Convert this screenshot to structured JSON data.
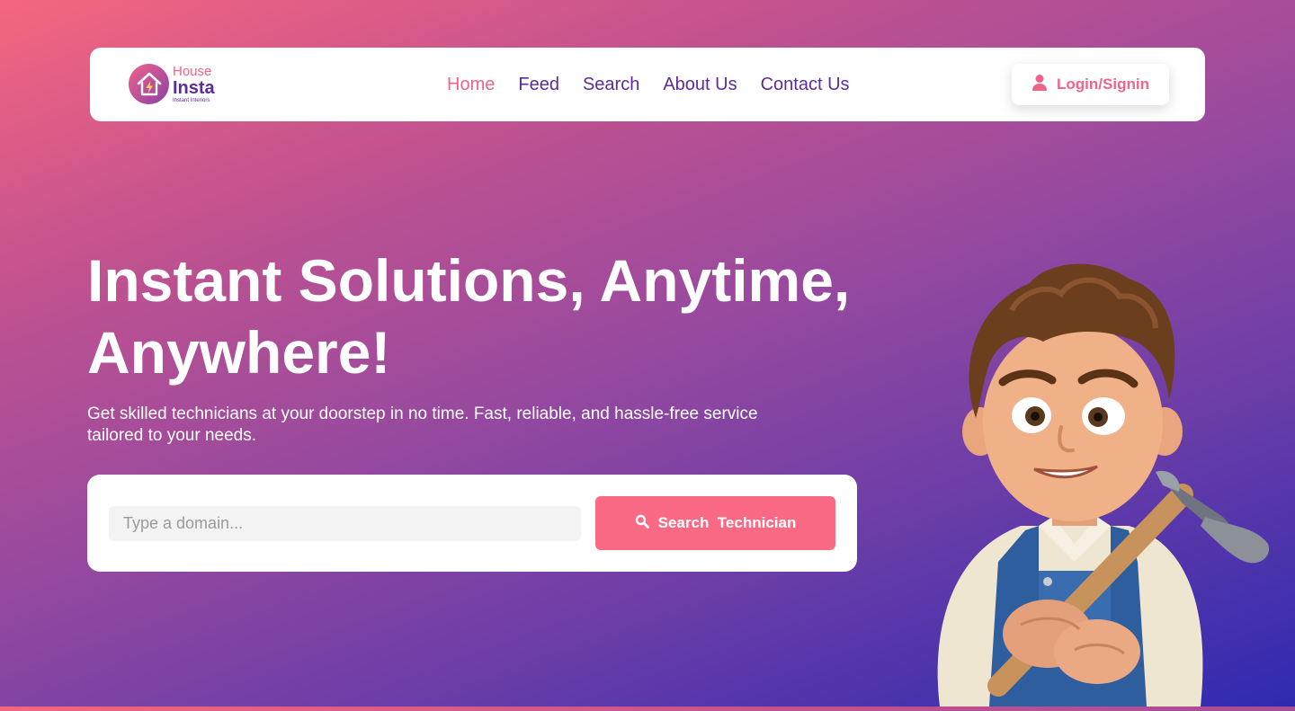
{
  "brand": {
    "name_top": "House",
    "name_main": "Insta",
    "tagline": "Instant Interiors"
  },
  "nav": {
    "links": [
      {
        "label": "Home",
        "active": true
      },
      {
        "label": "Feed",
        "active": false
      },
      {
        "label": "Search",
        "active": false
      },
      {
        "label": "About Us",
        "active": false
      },
      {
        "label": "Contact Us",
        "active": false
      }
    ],
    "login_label": "Login/Signin"
  },
  "hero": {
    "title_line1": "Instant Solutions, Anytime,",
    "title_line2": "Anywhere!",
    "subtitle": "Get skilled technicians at your doorstep in no time. Fast, reliable, and hassle-free service tailored to your needs."
  },
  "search": {
    "placeholder": "Type a domain...",
    "value": "",
    "button_label": "Search  Technician"
  },
  "icons": {
    "login": "user-icon",
    "search": "search-icon",
    "logo": "house-lightning-icon",
    "illustration": "technician-illustration"
  },
  "colors": {
    "accent": "#f0648a",
    "button": "#fb6a85",
    "nav_text": "#5b2d9c",
    "gradient_start": "#f5667f",
    "gradient_end": "#2f2ab0"
  }
}
